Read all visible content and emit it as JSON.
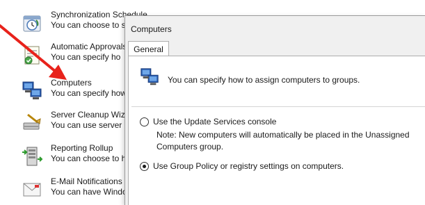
{
  "options_list": {
    "items": [
      {
        "title": "Synchronization Schedule",
        "desc": "You can choose to s",
        "icon": "sync-schedule-icon"
      },
      {
        "title": "Automatic Approvals",
        "desc": "You can specify ho",
        "icon": "automatic-approvals-icon"
      },
      {
        "title": "Computers",
        "desc": "You can specify how",
        "icon": "computers-icon"
      },
      {
        "title": "Server Cleanup Wiza",
        "desc": "You can use server c",
        "icon": "server-cleanup-icon"
      },
      {
        "title": "Reporting Rollup",
        "desc": "You can choose to ha",
        "icon": "reporting-rollup-icon"
      },
      {
        "title": "E-Mail Notifications",
        "desc": "You can have Windo",
        "icon": "email-notifications-icon"
      }
    ]
  },
  "dialog": {
    "title": "Computers",
    "tab": "General",
    "header_text": "You can specify how to assign computers to groups.",
    "option1_label": "Use the Update Services console",
    "note_line1": "Note: New computers will automatically be placed in the Unassigned",
    "note_line2": "Computers group.",
    "option2_label": "Use Group Policy or registry settings on computers.",
    "selected_option": "option2"
  },
  "colors": {
    "arrow": "#e8221b",
    "dialog_bg": "#f0f0f0",
    "panel_bg": "#ffffff"
  }
}
